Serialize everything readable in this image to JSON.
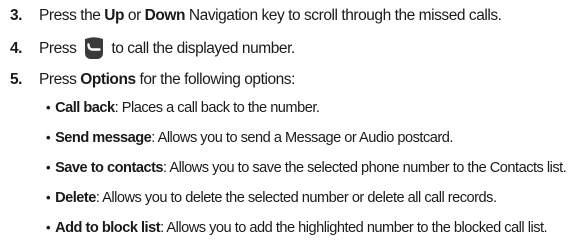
{
  "steps": [
    {
      "number": "3.",
      "parts": [
        "Press the ",
        "Up",
        " or ",
        "Down",
        " Navigation key to scroll through the missed calls."
      ]
    },
    {
      "number": "4.",
      "before": "Press",
      "icon": "send-key-icon",
      "after": "to call the displayed number."
    },
    {
      "number": "5.",
      "parts": [
        "Press ",
        "Options",
        " for the following options:"
      ]
    }
  ],
  "options": [
    {
      "term": "Call back",
      "desc": ": Places a call back to the number."
    },
    {
      "term": "Send message",
      "desc": ": Allows you to send a Message or Audio postcard."
    },
    {
      "term": "Save to contacts",
      "desc": ": Allows you to save the selected phone number to the Contacts list."
    },
    {
      "term": "Delete",
      "desc": ": Allows you to delete the selected number or delete all call records."
    },
    {
      "term": "Add to block list",
      "desc": ": Allows you to add the highlighted number to the blocked call list."
    }
  ],
  "bullet": "•",
  "colors": {
    "text": "#1a1a1a",
    "icon_fill": "#3a3a3a"
  }
}
